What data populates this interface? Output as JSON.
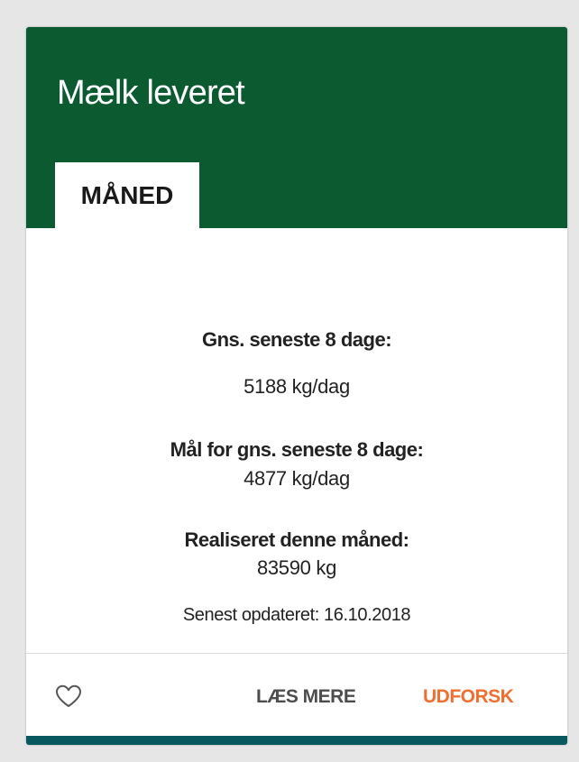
{
  "card": {
    "title": "Mælk leveret",
    "tab": "MÅNED",
    "stats": [
      {
        "label": "Gns. seneste 8 dage:",
        "value": "5188 kg/dag"
      },
      {
        "label": "Mål for gns. seneste 8 dage:",
        "value": "4877 kg/dag"
      },
      {
        "label": "Realiseret denne måned:",
        "value": "83590 kg"
      }
    ],
    "updated": "Senest opdateret: 16.10.2018",
    "actions": {
      "read_more": "LÆS MERE",
      "explore": "UDFORSK"
    },
    "colors": {
      "header": "#0b5a30",
      "accent": "#f26e2e",
      "bottom_bar": "#07595f"
    },
    "icons": {
      "favorite": "heart-icon"
    }
  }
}
